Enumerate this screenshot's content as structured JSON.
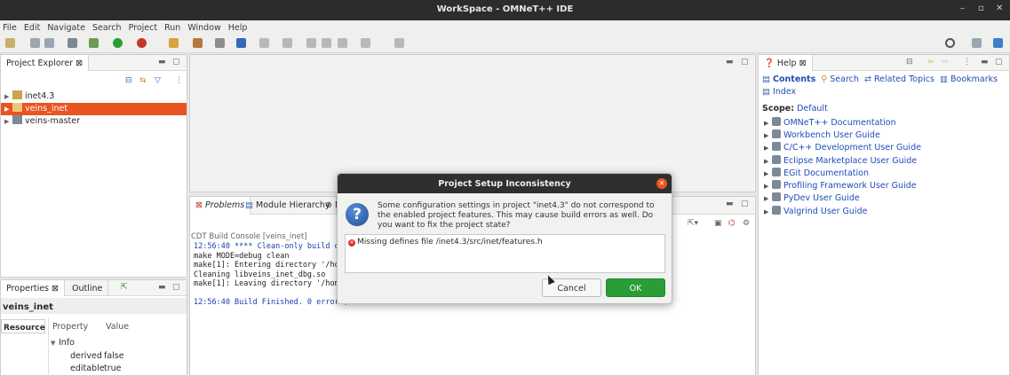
{
  "window": {
    "title": "WorkSpace - OMNeT++ IDE",
    "minimize": "–",
    "restore": "▫",
    "close": "✕"
  },
  "menu": [
    "File",
    "Edit",
    "Navigate",
    "Search",
    "Project",
    "Run",
    "Window",
    "Help"
  ],
  "project_explorer": {
    "tab_label": "Project Explorer",
    "items": [
      {
        "label": "inet4.3",
        "selected": false
      },
      {
        "label": "veins_inet",
        "selected": true
      },
      {
        "label": "veins-master",
        "selected": false
      }
    ]
  },
  "properties": {
    "tabs": [
      "Properties",
      "Outline"
    ],
    "title": "veins_inet",
    "side_tab": "Resource",
    "columns": [
      "Property",
      "Value"
    ],
    "group": "Info",
    "rows": [
      {
        "property": "derived",
        "value": "false"
      },
      {
        "property": "editable",
        "value": "true"
      }
    ]
  },
  "bottom_panel": {
    "tabs": [
      "Problems",
      "Module Hierarchy",
      "N"
    ],
    "console_title": "CDT Build Console [veins_inet]",
    "lines": [
      {
        "text": "12:56:40 **** Clean-only build of",
        "blue": true
      },
      {
        "text": "make MODE=debug clean",
        "blue": false
      },
      {
        "text": "make[1]: Entering directory '/home",
        "blue": false
      },
      {
        "text": "Cleaning libveins_inet_dbg.so",
        "blue": false
      },
      {
        "text": "make[1]: Leaving directory '/home,",
        "blue": false
      },
      {
        "text": "12:56:40 Build Finished. 0 errors,",
        "blue": true
      }
    ]
  },
  "help": {
    "tab_label": "Help",
    "nav": [
      "Contents",
      "Search",
      "Related Topics",
      "Bookmarks",
      "Index"
    ],
    "scope_label": "Scope:",
    "scope_value": "Default",
    "links": [
      "OMNeT++ Documentation",
      "Workbench User Guide",
      "C/C++ Development User Guide",
      "Eclipse Marketplace User Guide",
      "EGit Documentation",
      "Profiling Framework User Guide",
      "PyDev User Guide",
      "Valgrind User Guide"
    ]
  },
  "dialog": {
    "title": "Project Setup Inconsistency",
    "message": "Some configuration settings in project \"inet4.3\" do not correspond to the enabled project features. This may cause build errors as well. Do you want to fix the project state?",
    "error_item": "Missing defines file /inet4.3/src/inet/features.h",
    "cancel_label": "Cancel",
    "ok_label": "OK",
    "question_glyph": "?"
  },
  "colors": {
    "accent": "#e95420",
    "ok": "#2a9d36",
    "link": "#1f4db8"
  }
}
